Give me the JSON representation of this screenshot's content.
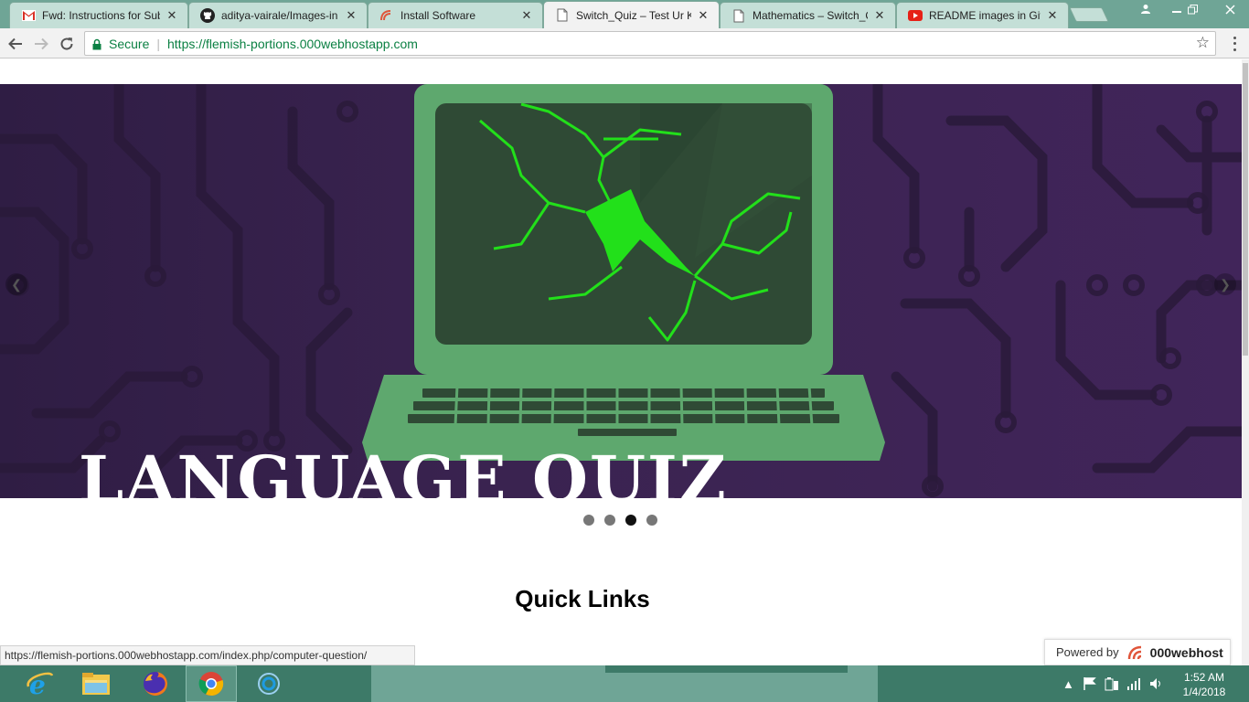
{
  "browser": {
    "tabs": [
      {
        "title": "Fwd: Instructions for Sub",
        "icon": "gmail-icon",
        "active": false
      },
      {
        "title": "aditya-vairale/Images-in",
        "icon": "github-icon",
        "active": false
      },
      {
        "title": "Install Software",
        "icon": "site-icon",
        "active": false
      },
      {
        "title": "Switch_Quiz – Test Ur Kn",
        "icon": "page-icon",
        "active": true
      },
      {
        "title": "Mathematics – Switch_Q",
        "icon": "page-icon",
        "active": false
      },
      {
        "title": "README images in Githu",
        "icon": "youtube-icon",
        "active": false
      }
    ],
    "close_glyph": "✕",
    "address": {
      "secure_label": "Secure",
      "url": "https://flemish-portions.000webhostapp.com"
    }
  },
  "page": {
    "hero": {
      "caption": "LANGUAGE QUIZ",
      "slide_count": 4,
      "active_slide": 3
    },
    "section_heading": "Quick Links",
    "status_url": "https://flemish-portions.000webhostapp.com/index.php/computer-question/",
    "powered_by": {
      "label": "Powered by",
      "brand": "000webhost"
    }
  },
  "taskbar": {
    "apps": [
      "internet-explorer",
      "file-explorer",
      "firefox",
      "chrome",
      "cortana"
    ],
    "clock": {
      "time": "1:52 AM",
      "date": "1/4/2018"
    }
  },
  "colors": {
    "tabstrip": "#6fa596",
    "hero_bg": "#3a2350",
    "laptop": "#5ea86e",
    "crack": "#22e01a",
    "taskbar": "#3d7a68"
  }
}
